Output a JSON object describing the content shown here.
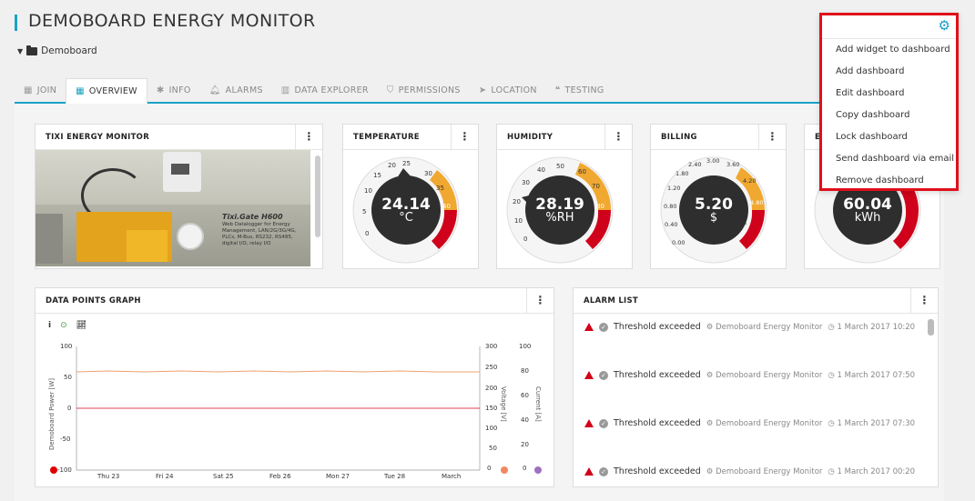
{
  "header": {
    "title": "DEMOBOARD ENERGY MONITOR",
    "breadcrumb": "Demoboard"
  },
  "tabs": [
    {
      "label": "JOIN",
      "icon": "grid-icon"
    },
    {
      "label": "OVERVIEW",
      "icon": "grid-icon",
      "active": true
    },
    {
      "label": "INFO",
      "icon": "asterisk-icon"
    },
    {
      "label": "ALARMS",
      "icon": "bell-icon"
    },
    {
      "label": "DATA EXPLORER",
      "icon": "bar-chart-icon"
    },
    {
      "label": "PERMISSIONS",
      "icon": "shield-icon"
    },
    {
      "label": "LOCATION",
      "icon": "location-arrow-icon"
    },
    {
      "label": "TESTING",
      "icon": "quote-icon"
    }
  ],
  "widgets": {
    "image": {
      "title": "TIXI ENERGY MONITOR",
      "caption_title": "Tixi.Gate H600",
      "caption_text": "Web Datalogger for Energy Management, LAN/2G/3G/4G, PLCs, M-Bus, RS232, RS485, digital I/O, relay I/O"
    },
    "temperature": {
      "title": "TEMPERATURE",
      "value": "24.14",
      "unit": "°C",
      "ticks": [
        "0",
        "5",
        "10",
        "15",
        "20",
        "25",
        "30",
        "35",
        "40"
      ]
    },
    "humidity": {
      "title": "HUMIDITY",
      "value": "28.19",
      "unit": "%RH",
      "ticks": [
        "0",
        "10",
        "20",
        "30",
        "40",
        "50",
        "60",
        "70",
        "80"
      ]
    },
    "billing": {
      "title": "BILLING",
      "value": "5.20",
      "unit": "$",
      "ticks": [
        "0.00",
        "0.40",
        "0.80",
        "1.20",
        "1.80",
        "2.40",
        "3.00",
        "3.60",
        "4.20",
        "4.80"
      ]
    },
    "energy": {
      "title": "E",
      "value": "60.04",
      "unit": "kWh"
    },
    "graph": {
      "title": "DATA POINTS GRAPH",
      "left_axis_title": "Demoboard Power [W]",
      "mid_axis_title": "Voltage [V]",
      "right_axis_title": "Current [A]",
      "left_ticks": [
        "100",
        "50",
        "0",
        "-50",
        "-100"
      ],
      "mid_ticks": [
        "300",
        "250",
        "200",
        "150",
        "100",
        "50",
        "0"
      ],
      "right_ticks": [
        "100",
        "80",
        "60",
        "40",
        "20",
        "0"
      ],
      "x_ticks": [
        "Thu 23",
        "Fri 24",
        "Sat 25",
        "Feb 26",
        "Mon 27",
        "Tue 28",
        "March"
      ]
    },
    "alarms": {
      "title": "ALARM LIST",
      "items": [
        {
          "text": "Threshold exceeded",
          "source": "Demoboard Energy Monitor",
          "time": "1 March 2017 10:20"
        },
        {
          "text": "Threshold exceeded",
          "source": "Demoboard Energy Monitor",
          "time": "1 March 2017 07:50"
        },
        {
          "text": "Threshold exceeded",
          "source": "Demoboard Energy Monitor",
          "time": "1 March 2017 07:30"
        },
        {
          "text": "Threshold exceeded",
          "source": "Demoboard Energy Monitor",
          "time": "1 March 2017 00:20"
        }
      ]
    }
  },
  "menu": {
    "items": [
      "Add widget to dashboard",
      "Add dashboard",
      "Edit dashboard",
      "Copy dashboard",
      "Lock dashboard",
      "Send dashboard via email",
      "Remove dashboard"
    ]
  },
  "colors": {
    "accent": "#1aa3c4",
    "orange": "#f0a830",
    "red": "#d0021b",
    "gauge_dark": "#2e2e2e"
  }
}
